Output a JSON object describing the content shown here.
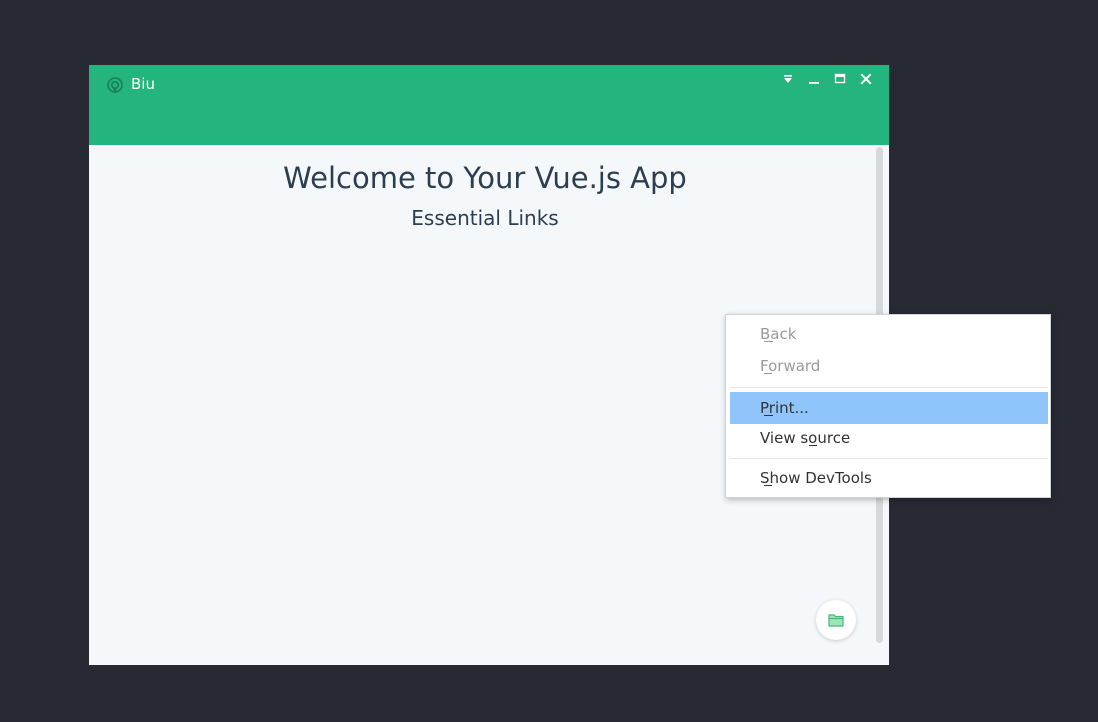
{
  "window": {
    "app_name": "Biu",
    "controls": [
      "tray-menu-icon",
      "minimize-icon",
      "maximize-icon",
      "close-icon"
    ]
  },
  "content": {
    "title": "Welcome to Your Vue.js App",
    "subtitle": "Essential Links"
  },
  "context_menu": {
    "items": [
      {
        "label": "Back",
        "enabled": false
      },
      {
        "label": "Forward",
        "enabled": false
      },
      {
        "label": "Print...",
        "enabled": true,
        "highlighted": true
      },
      {
        "label": "View source",
        "enabled": true
      },
      {
        "label": "Show DevTools",
        "enabled": true
      }
    ]
  },
  "fab": {
    "icon": "folder-icon"
  },
  "colors": {
    "desktop": "#272a33",
    "titlebar": "#24b47e",
    "content_bg": "#f4f8fb",
    "text": "#2c3e50",
    "menu_highlight": "#90c5fc",
    "folder_icon": "#42b983"
  }
}
